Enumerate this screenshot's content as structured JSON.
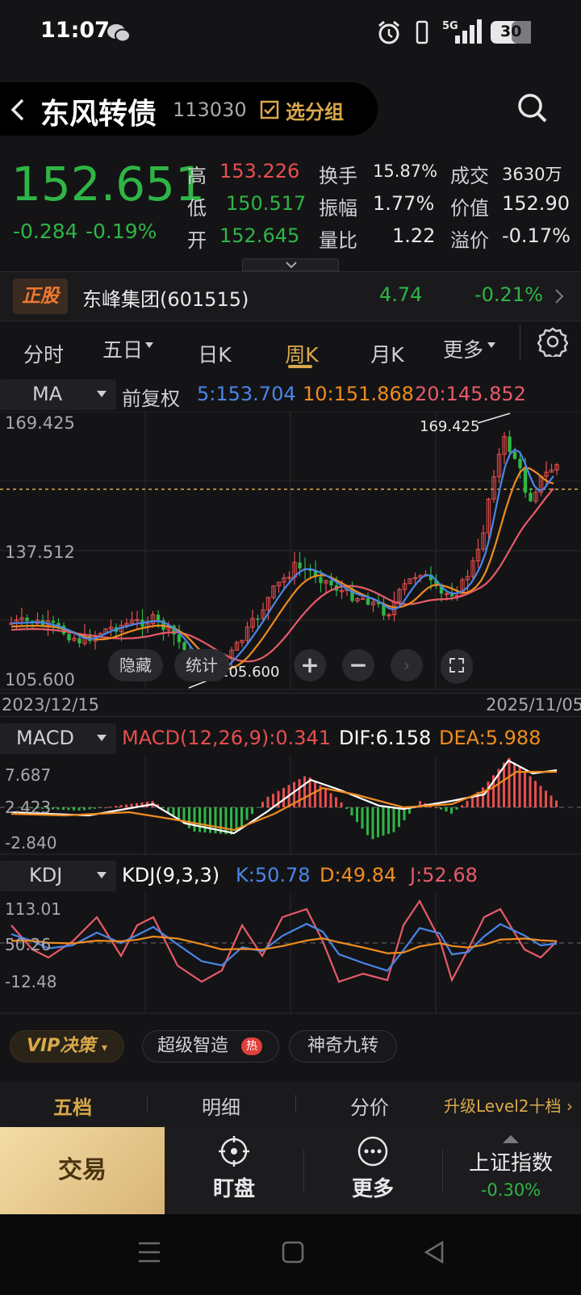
{
  "status_bar": {
    "time": "11:07",
    "network": "5G",
    "battery": "30"
  },
  "header": {
    "name": "东风转债",
    "code": "113030",
    "group_button": "选分组"
  },
  "quote": {
    "price": "152.651",
    "change": "-0.284",
    "change_pct": "-0.19%",
    "high_label": "高",
    "high": "153.226",
    "low_label": "低",
    "low": "150.517",
    "open_label": "开",
    "open": "152.645",
    "turnover_label": "换手",
    "turnover": "15.87%",
    "amplitude_label": "振幅",
    "amplitude": "1.77%",
    "volume_ratio_label": "量比",
    "volume_ratio": "1.22",
    "amount_label": "成交",
    "amount": "3630万",
    "value_label": "价值",
    "value": "152.90",
    "premium_label": "溢价",
    "premium": "-0.17%"
  },
  "underlying": {
    "badge": "正股",
    "name": "东峰集团(601515)",
    "price": "4.74",
    "change_pct": "-0.21%"
  },
  "period_tabs": [
    {
      "label": "分时"
    },
    {
      "label": "五日"
    },
    {
      "label": "日K"
    },
    {
      "label": "周K"
    },
    {
      "label": "月K"
    },
    {
      "label": "更多"
    }
  ],
  "active_tab": "周K",
  "main_chart": {
    "indicator": "MA",
    "adjust": "前复权",
    "ma5": "5:153.704",
    "ma10": "10:151.868",
    "ma20": "20:145.852",
    "y_top": "169.425",
    "y_mid": "137.512",
    "y_bottom": "105.600",
    "max_label": "169.425",
    "min_label": "105.600",
    "date_start": "2023/12/15",
    "date_end": "2025/11/05",
    "hide_button": "隐藏",
    "stats_button": "统计"
  },
  "macd": {
    "indicator": "MACD",
    "params": "MACD(12,26,9):0.341",
    "dif": "DIF:6.158",
    "dea": "DEA:5.988",
    "y_top": "7.687",
    "y_mid": "2.423",
    "y_bottom": "-2.840"
  },
  "kdj": {
    "indicator": "KDJ",
    "params": "KDJ(9,3,3)",
    "k": "K:50.78",
    "d": "D:49.84",
    "j": "J:52.68",
    "y_top": "113.01",
    "y_mid": "50.26",
    "y_bottom": "-12.48"
  },
  "strategy": {
    "vip": "VIP决策",
    "item1": "超级智造",
    "hot": "热",
    "item2": "神奇九转"
  },
  "sub_tabs": {
    "tab1": "五档",
    "tab2": "明细",
    "tab3": "分价",
    "upgrade": "升级Level2十档"
  },
  "action_bar": {
    "trade": "交易",
    "watch": "盯盘",
    "more": "更多",
    "index_name": "上证指数",
    "index_change": "-0.30%"
  },
  "colors": {
    "up": "#e84e4e",
    "down": "#2fb545",
    "ma5": "#4a86e8",
    "ma10": "#f08c1f",
    "ma20": "#e85a6a",
    "accent": "#d9a94a"
  }
}
